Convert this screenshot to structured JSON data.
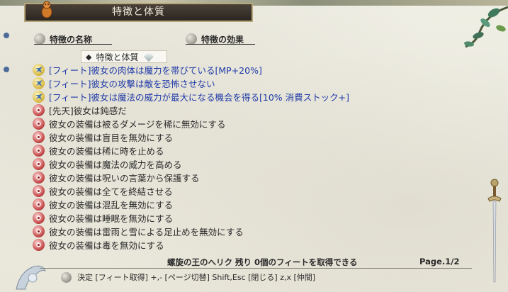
{
  "title": "特徴と体質",
  "headers": {
    "name": "特徴の名称",
    "effect": "特徴の効果"
  },
  "category": {
    "label": "特徴と体質",
    "bullet": "◆"
  },
  "rows": [
    {
      "kind": "feature",
      "text": "[フィート]彼女の肉体は魔力を帯びている[MP+20%]"
    },
    {
      "kind": "feature",
      "text": "[フィート]彼女の攻撃は敵を恐怖させない"
    },
    {
      "kind": "feature",
      "text": "[フィート]彼女は魔法の威力が最大になる機会を得る[10% 消費ストック+]"
    },
    {
      "kind": "innate",
      "text": "[先天]彼女は鈍感だ"
    },
    {
      "kind": "innate",
      "text": "彼女の装備は被るダメージを稀に無効にする"
    },
    {
      "kind": "innate",
      "text": "彼女の装備は盲目を無効にする"
    },
    {
      "kind": "innate",
      "text": "彼女の装備は稀に時を止める"
    },
    {
      "kind": "innate",
      "text": "彼女の装備は魔法の威力を高める"
    },
    {
      "kind": "innate",
      "text": "彼女の装備は呪いの言葉から保護する"
    },
    {
      "kind": "innate",
      "text": "彼女の装備は全てを終結させる"
    },
    {
      "kind": "innate",
      "text": "彼女の装備は混乱を無効にする"
    },
    {
      "kind": "innate",
      "text": "彼女の装備は睡眠を無効にする"
    },
    {
      "kind": "innate",
      "text": "彼女の装備は雷雨と雪による足止めを無効にする"
    },
    {
      "kind": "innate",
      "text": "彼女の装備は毒を無効にする"
    }
  ],
  "status": {
    "message": "螺旋の王のへリク 残り 0個のフィートを取得できる",
    "page": "Page.1/2"
  },
  "footer": {
    "hint": "決定 [フィート取得] +,- [ページ切替] Shift,Esc [閉じる] z,x [仲間]"
  },
  "colors": {
    "feature_text": "#1f3aa8",
    "normal_text": "#2a2a2a",
    "title_bg": "#2c2621",
    "parchment": "#ecebe0"
  }
}
